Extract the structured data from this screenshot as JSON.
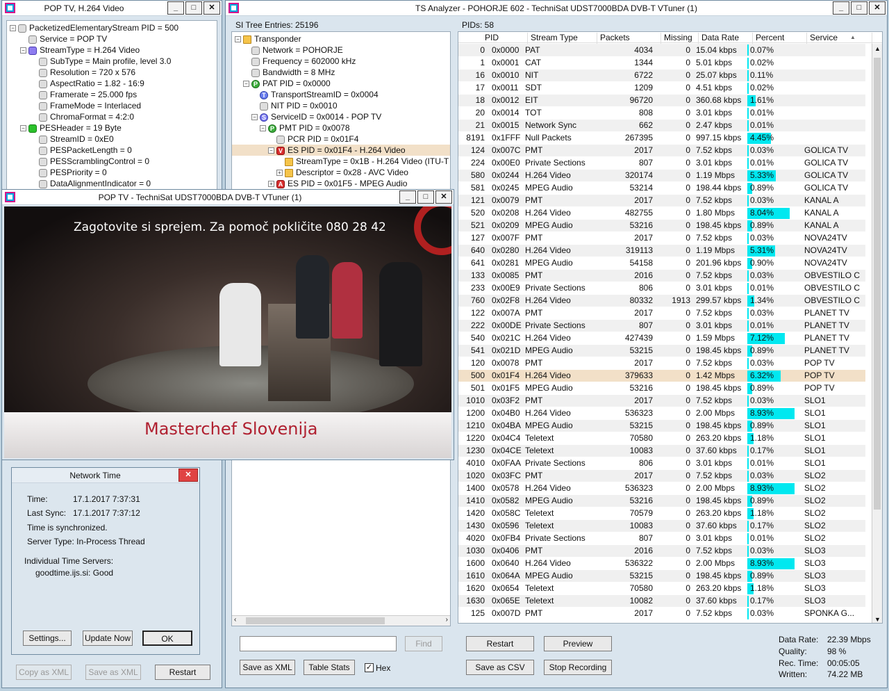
{
  "pes_window": {
    "title": "POP TV, H.264 Video",
    "items": [
      {
        "level": 0,
        "exp": "−",
        "icon": "",
        "label": "PacketizedElementaryStream PID = 500"
      },
      {
        "level": 1,
        "exp": "",
        "icon": "",
        "label": "Service = POP TV"
      },
      {
        "level": 1,
        "exp": "−",
        "icon": "blue",
        "label": "StreamType = H.264 Video"
      },
      {
        "level": 2,
        "exp": "",
        "icon": "",
        "label": "SubType = Main profile, level 3.0"
      },
      {
        "level": 2,
        "exp": "",
        "icon": "",
        "label": "Resolution = 720 x 576"
      },
      {
        "level": 2,
        "exp": "",
        "icon": "",
        "label": "AspectRatio = 1.82 - 16:9"
      },
      {
        "level": 2,
        "exp": "",
        "icon": "",
        "label": "Framerate = 25.000 fps"
      },
      {
        "level": 2,
        "exp": "",
        "icon": "",
        "label": "FrameMode = Interlaced"
      },
      {
        "level": 2,
        "exp": "",
        "icon": "",
        "label": "ChromaFormat = 4:2:0"
      },
      {
        "level": 1,
        "exp": "−",
        "icon": "green",
        "label": "PESHeader = 19 Byte"
      },
      {
        "level": 2,
        "exp": "",
        "icon": "",
        "label": "StreamID = 0xE0"
      },
      {
        "level": 2,
        "exp": "",
        "icon": "",
        "label": "PESPacketLength = 0"
      },
      {
        "level": 2,
        "exp": "",
        "icon": "",
        "label": "PESScramblingControl = 0"
      },
      {
        "level": 2,
        "exp": "",
        "icon": "",
        "label": "PESPriority = 0"
      },
      {
        "level": 2,
        "exp": "",
        "icon": "",
        "label": "DataAlignmentIndicator = 0"
      }
    ],
    "copy_xml": "Copy as XML",
    "save_xml": "Save as XML",
    "restart": "Restart"
  },
  "network_time": {
    "title": "Network Time",
    "time_label": "Time:",
    "time_value": "17.1.2017 7:37:31",
    "sync_label": "Last Sync:",
    "sync_value": "17.1.2017 7:37:12",
    "sync_status": "Time is synchronized.",
    "server_type": "Server Type: In-Process Thread",
    "servers_label": "Individual Time Servers:",
    "server": "goodtime.ijs.si: Good",
    "settings": "Settings...",
    "update": "Update Now",
    "ok": "OK"
  },
  "video_window": {
    "title": "POP TV - TechniSat UDST7000BDA DVB-T VTuner (1)",
    "banner": "Zagotovite si sprejem. Za pomoč pokličite 080 28 42",
    "caption": "Masterchef Slovenija"
  },
  "main_window": {
    "title": "TS Analyzer - POHORJE 602 - TechniSat UDST7000BDA DVB-T VTuner (1)"
  },
  "si_tree": {
    "header": "SI Tree Entries: 25196",
    "items": [
      {
        "level": 0,
        "exp": "−",
        "icon": "folder",
        "label": "Transponder"
      },
      {
        "level": 1,
        "exp": "",
        "icon": "",
        "label": "Network = POHORJE"
      },
      {
        "level": 1,
        "exp": "",
        "icon": "",
        "label": "Frequency = 602000 kHz"
      },
      {
        "level": 1,
        "exp": "",
        "icon": "",
        "label": "Bandwidth = 8 MHz"
      },
      {
        "level": 1,
        "exp": "−",
        "icon": "P",
        "badge": "P",
        "label": "PAT PID = 0x0000"
      },
      {
        "level": 2,
        "exp": "",
        "icon": "T",
        "badge": "T",
        "label": "TransportStreamID = 0x0004"
      },
      {
        "level": 2,
        "exp": "",
        "icon": "",
        "label": "NIT PID = 0x0010"
      },
      {
        "level": 2,
        "exp": "−",
        "icon": "S",
        "badge": "S",
        "label": "ServiceID = 0x0014 - POP TV"
      },
      {
        "level": 3,
        "exp": "−",
        "icon": "P",
        "badge": "P",
        "label": "PMT PID = 0x0078"
      },
      {
        "level": 4,
        "exp": "",
        "icon": "",
        "label": "PCR PID = 0x01F4"
      },
      {
        "level": 4,
        "exp": "−",
        "icon": "V",
        "badge": "V",
        "label": "ES PID = 0x01F4 - H.264 Video",
        "sel": true
      },
      {
        "level": 5,
        "exp": "",
        "icon": "folder",
        "label": "StreamType = 0x1B - H.264 Video (ITU-T"
      },
      {
        "level": 5,
        "exp": "+",
        "icon": "folder",
        "label": "Descriptor = 0x28 - AVC Video"
      },
      {
        "level": 4,
        "exp": "+",
        "icon": "A",
        "badge": "A",
        "label": "ES PID = 0x01F5 - MPEG Audio"
      }
    ],
    "find": "Find",
    "save_xml": "Save as XML",
    "table_stats": "Table Stats",
    "hex": "Hex"
  },
  "pid_table": {
    "header": "PIDs: 58",
    "columns": [
      "PID",
      "Stream Type",
      "Packets",
      "Missing",
      "Data Rate",
      "Percent",
      "Service"
    ],
    "rows": [
      [
        "0",
        "0x0000",
        "PAT",
        "4034",
        "0",
        "15.04 kbps",
        "0.07%",
        "",
        0.07
      ],
      [
        "1",
        "0x0001",
        "CAT",
        "1344",
        "0",
        "5.01 kbps",
        "0.02%",
        "",
        0.02
      ],
      [
        "16",
        "0x0010",
        "NIT",
        "6722",
        "0",
        "25.07 kbps",
        "0.11%",
        "",
        0.11
      ],
      [
        "17",
        "0x0011",
        "SDT",
        "1209",
        "0",
        "4.51 kbps",
        "0.02%",
        "",
        0.02
      ],
      [
        "18",
        "0x0012",
        "EIT",
        "96720",
        "0",
        "360.68 kbps",
        "1.61%",
        "",
        1.61
      ],
      [
        "20",
        "0x0014",
        "TOT",
        "808",
        "0",
        "3.01 kbps",
        "0.01%",
        "",
        0.01
      ],
      [
        "21",
        "0x0015",
        "Network Sync",
        "662",
        "0",
        "2.47 kbps",
        "0.01%",
        "",
        0.01
      ],
      [
        "8191",
        "0x1FFF",
        "Null Packets",
        "267395",
        "0",
        "997.15 kbps",
        "4.45%",
        "",
        4.45
      ],
      [
        "124",
        "0x007C",
        "PMT",
        "2017",
        "0",
        "7.52 kbps",
        "0.03%",
        "GOLICA TV",
        0.03
      ],
      [
        "224",
        "0x00E0",
        "Private Sections",
        "807",
        "0",
        "3.01 kbps",
        "0.01%",
        "GOLICA TV",
        0.01
      ],
      [
        "580",
        "0x0244",
        "H.264 Video",
        "320174",
        "0",
        "1.19 Mbps",
        "5.33%",
        "GOLICA TV",
        5.33
      ],
      [
        "581",
        "0x0245",
        "MPEG Audio",
        "53214",
        "0",
        "198.44 kbps",
        "0.89%",
        "GOLICA TV",
        0.89
      ],
      [
        "121",
        "0x0079",
        "PMT",
        "2017",
        "0",
        "7.52 kbps",
        "0.03%",
        "KANAL A",
        0.03
      ],
      [
        "520",
        "0x0208",
        "H.264 Video",
        "482755",
        "0",
        "1.80 Mbps",
        "8.04%",
        "KANAL A",
        8.04
      ],
      [
        "521",
        "0x0209",
        "MPEG Audio",
        "53216",
        "0",
        "198.45 kbps",
        "0.89%",
        "KANAL A",
        0.89
      ],
      [
        "127",
        "0x007F",
        "PMT",
        "2017",
        "0",
        "7.52 kbps",
        "0.03%",
        "NOVA24TV",
        0.03
      ],
      [
        "640",
        "0x0280",
        "H.264 Video",
        "319113",
        "0",
        "1.19 Mbps",
        "5.31%",
        "NOVA24TV",
        5.31
      ],
      [
        "641",
        "0x0281",
        "MPEG Audio",
        "54158",
        "0",
        "201.96 kbps",
        "0.90%",
        "NOVA24TV",
        0.9
      ],
      [
        "133",
        "0x0085",
        "PMT",
        "2016",
        "0",
        "7.52 kbps",
        "0.03%",
        "OBVESTILO C",
        0.03
      ],
      [
        "233",
        "0x00E9",
        "Private Sections",
        "806",
        "0",
        "3.01 kbps",
        "0.01%",
        "OBVESTILO C",
        0.01
      ],
      [
        "760",
        "0x02F8",
        "H.264 Video",
        "80332",
        "1913",
        "299.57 kbps",
        "1.34%",
        "OBVESTILO C",
        1.34
      ],
      [
        "122",
        "0x007A",
        "PMT",
        "2017",
        "0",
        "7.52 kbps",
        "0.03%",
        "PLANET TV",
        0.03
      ],
      [
        "222",
        "0x00DE",
        "Private Sections",
        "807",
        "0",
        "3.01 kbps",
        "0.01%",
        "PLANET TV",
        0.01
      ],
      [
        "540",
        "0x021C",
        "H.264 Video",
        "427439",
        "0",
        "1.59 Mbps",
        "7.12%",
        "PLANET TV",
        7.12
      ],
      [
        "541",
        "0x021D",
        "MPEG Audio",
        "53215",
        "0",
        "198.45 kbps",
        "0.89%",
        "PLANET TV",
        0.89
      ],
      [
        "120",
        "0x0078",
        "PMT",
        "2017",
        "0",
        "7.52 kbps",
        "0.03%",
        "POP TV",
        0.03
      ],
      [
        "500",
        "0x01F4",
        "H.264 Video",
        "379633",
        "0",
        "1.42 Mbps",
        "6.32%",
        "POP TV",
        6.32,
        "sel"
      ],
      [
        "501",
        "0x01F5",
        "MPEG Audio",
        "53216",
        "0",
        "198.45 kbps",
        "0.89%",
        "POP TV",
        0.89
      ],
      [
        "1010",
        "0x03F2",
        "PMT",
        "2017",
        "0",
        "7.52 kbps",
        "0.03%",
        "SLO1",
        0.03
      ],
      [
        "1200",
        "0x04B0",
        "H.264 Video",
        "536323",
        "0",
        "2.00 Mbps",
        "8.93%",
        "SLO1",
        8.93
      ],
      [
        "1210",
        "0x04BA",
        "MPEG Audio",
        "53215",
        "0",
        "198.45 kbps",
        "0.89%",
        "SLO1",
        0.89
      ],
      [
        "1220",
        "0x04C4",
        "Teletext",
        "70580",
        "0",
        "263.20 kbps",
        "1.18%",
        "SLO1",
        1.18
      ],
      [
        "1230",
        "0x04CE",
        "Teletext",
        "10083",
        "0",
        "37.60 kbps",
        "0.17%",
        "SLO1",
        0.17
      ],
      [
        "4010",
        "0x0FAA",
        "Private Sections",
        "806",
        "0",
        "3.01 kbps",
        "0.01%",
        "SLO1",
        0.01
      ],
      [
        "1020",
        "0x03FC",
        "PMT",
        "2017",
        "0",
        "7.52 kbps",
        "0.03%",
        "SLO2",
        0.03
      ],
      [
        "1400",
        "0x0578",
        "H.264 Video",
        "536323",
        "0",
        "2.00 Mbps",
        "8.93%",
        "SLO2",
        8.93
      ],
      [
        "1410",
        "0x0582",
        "MPEG Audio",
        "53216",
        "0",
        "198.45 kbps",
        "0.89%",
        "SLO2",
        0.89
      ],
      [
        "1420",
        "0x058C",
        "Teletext",
        "70579",
        "0",
        "263.20 kbps",
        "1.18%",
        "SLO2",
        1.18
      ],
      [
        "1430",
        "0x0596",
        "Teletext",
        "10083",
        "0",
        "37.60 kbps",
        "0.17%",
        "SLO2",
        0.17
      ],
      [
        "4020",
        "0x0FB4",
        "Private Sections",
        "807",
        "0",
        "3.01 kbps",
        "0.01%",
        "SLO2",
        0.01
      ],
      [
        "1030",
        "0x0406",
        "PMT",
        "2016",
        "0",
        "7.52 kbps",
        "0.03%",
        "SLO3",
        0.03
      ],
      [
        "1600",
        "0x0640",
        "H.264 Video",
        "536322",
        "0",
        "2.00 Mbps",
        "8.93%",
        "SLO3",
        8.93
      ],
      [
        "1610",
        "0x064A",
        "MPEG Audio",
        "53215",
        "0",
        "198.45 kbps",
        "0.89%",
        "SLO3",
        0.89
      ],
      [
        "1620",
        "0x0654",
        "Teletext",
        "70580",
        "0",
        "263.20 kbps",
        "1.18%",
        "SLO3",
        1.18
      ],
      [
        "1630",
        "0x065E",
        "Teletext",
        "10082",
        "0",
        "37.60 kbps",
        "0.17%",
        "SLO3",
        0.17
      ],
      [
        "125",
        "0x007D",
        "PMT",
        "2017",
        "0",
        "7.52 kbps",
        "0.03%",
        "SPONKA G...",
        0.03
      ]
    ],
    "restart": "Restart",
    "preview": "Preview",
    "save_csv": "Save as CSV",
    "stop_rec": "Stop Recording"
  },
  "stats": {
    "data_rate_label": "Data Rate:",
    "data_rate": "22.39 Mbps",
    "quality_label": "Quality:",
    "quality": "98 %",
    "rec_time_label": "Rec. Time:",
    "rec_time": "00:05:05",
    "written_label": "Written:",
    "written": "74.22 MB"
  },
  "colors": {
    "bar": "#00e8f0",
    "selection": "#f2e0c8"
  }
}
